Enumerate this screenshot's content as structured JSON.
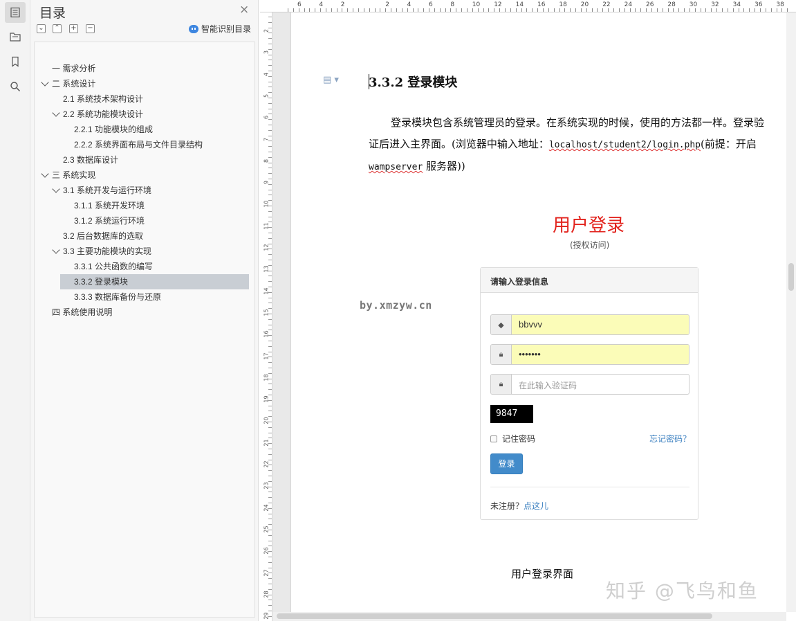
{
  "rail": {
    "icons": [
      "toc-icon",
      "folder-tree-icon",
      "bookmark-icon",
      "search-icon"
    ]
  },
  "toc": {
    "title": "目录",
    "close": "×",
    "tools": [
      "⌄",
      "⌃",
      "+",
      "−"
    ],
    "smart_label": "智能识别目录",
    "items": [
      {
        "label": "一   需求分析"
      },
      {
        "label": "二  系统设计"
      },
      {
        "label": "2.1  系统技术架构设计"
      },
      {
        "label": "2.2  系统功能模块设计"
      },
      {
        "label": "2.2.1 功能模块的组成"
      },
      {
        "label": "2.2.2 系统界面布局与文件目录结构"
      },
      {
        "label": "2.3  数据库设计"
      },
      {
        "label": "三  系统实现"
      },
      {
        "label": "3.1 系统开发与运行环境"
      },
      {
        "label": "3.1.1  系统开发环境"
      },
      {
        "label": "3.1.2  系统运行环境"
      },
      {
        "label": "3.2  后台数据库的选取"
      },
      {
        "label": "3.3  主要功能模块的实现"
      },
      {
        "label": "3.3.1  公共函数的编写"
      },
      {
        "label": "3.3.2  登录模块"
      },
      {
        "label": "3.3.3  数据库备份与还原"
      },
      {
        "label": "四  系统使用说明"
      }
    ]
  },
  "ruler": {
    "h_numbers": [
      "6",
      "4",
      "2",
      "2",
      "4",
      "6",
      "8",
      "10",
      "12",
      "14",
      "16",
      "18",
      "20",
      "22",
      "24",
      "26",
      "28",
      "30",
      "32",
      "34",
      "36",
      "38"
    ],
    "v_numbers": [
      "2",
      "3",
      "4",
      "5",
      "6",
      "7",
      "8",
      "9",
      "10",
      "11",
      "12",
      "13",
      "14",
      "15",
      "16",
      "17",
      "18",
      "19",
      "20",
      "21",
      "22",
      "23",
      "24",
      "25",
      "26",
      "27",
      "28",
      "29"
    ]
  },
  "doc": {
    "heading": "3.3.2  登录模块",
    "para_1": "登录模块包含系统管理员的登录。在系统实现的时候，使用的方法都一样。登录验证后进入主界面。(浏览器中输入地址：",
    "para_url": "localhost/student2/login.php",
    "para_2": "(前提：开启 ",
    "para_server": "wampserver",
    "para_3": " 服务器))",
    "watermark_site": "by.xmzyw.cn",
    "watermark_zhihu": "知乎 @飞鸟和鱼",
    "caption": "用户登录界面"
  },
  "login": {
    "title": "用户登录",
    "subtitle": "(授权访问)",
    "panel_heading": "请输入登录信息",
    "username": "bbvvv",
    "password": "•••••••",
    "captcha_placeholder": "在此输入验证码",
    "captcha_code": "9847",
    "remember": "记住密码",
    "forgot": "忘记密码？",
    "submit": "登录",
    "register_prefix": "未注册？",
    "register_link": "点这儿"
  }
}
